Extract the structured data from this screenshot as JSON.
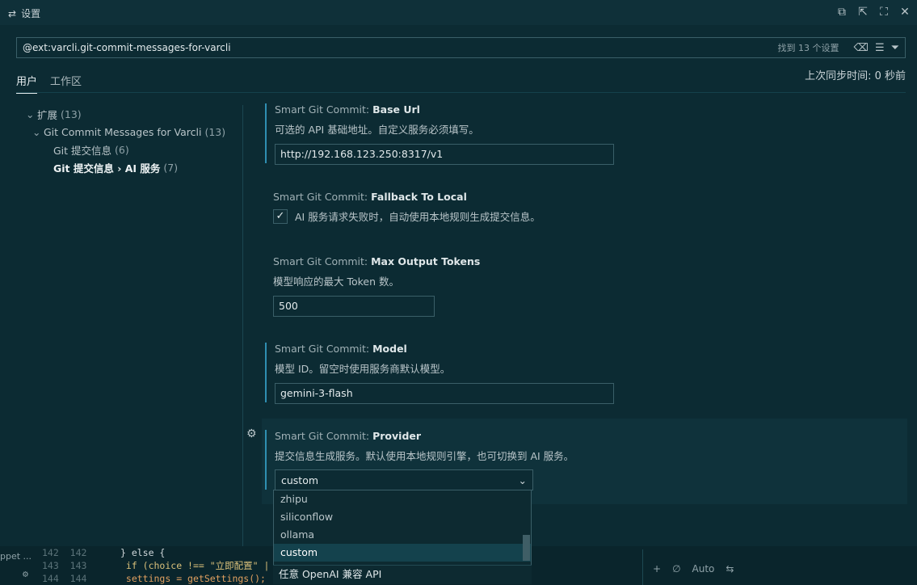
{
  "window": {
    "title": "设置",
    "title_icon": "settings-split-icon",
    "actions": [
      "copy-icon",
      "open-json-icon",
      "maximize-icon",
      "close-icon"
    ]
  },
  "search": {
    "value": "@ext:varcli.git-commit-messages-for-varcli",
    "result_count": "找到 13 个设置",
    "icons": [
      "clear-filter-icon",
      "list-icon",
      "filter-icon"
    ]
  },
  "tabs": [
    {
      "label": "用户",
      "active": true
    },
    {
      "label": "工作区",
      "active": false
    }
  ],
  "sync_status": "上次同步时间: 0 秒前",
  "tree": [
    {
      "label": "扩展",
      "count": "(13)",
      "expanded": true
    },
    {
      "label": "Git Commit Messages for Varcli",
      "count": "(13)",
      "expanded": true
    },
    {
      "label": "Git 提交信息",
      "count": "(6)"
    },
    {
      "label": "Git 提交信息 › AI 服务",
      "count": "(7)",
      "selected": true
    }
  ],
  "settings": {
    "base_url": {
      "prefix": "Smart Git Commit: ",
      "name": "Base Url",
      "desc": "可选的 API 基础地址。自定义服务必须填写。",
      "value": "http://192.168.123.250:8317/v1"
    },
    "fallback": {
      "prefix": "Smart Git Commit: ",
      "name": "Fallback To Local",
      "desc": "AI 服务请求失败时，自动使用本地规则生成提交信息。",
      "checked": true,
      "check_glyph": "✓"
    },
    "max_tokens": {
      "prefix": "Smart Git Commit: ",
      "name": "Max Output Tokens",
      "desc": "模型响应的最大 Token 数。",
      "value": "500"
    },
    "model": {
      "prefix": "Smart Git Commit: ",
      "name": "Model",
      "desc": "模型 ID。留空时使用服务商默认模型。",
      "value": "gemini-3-flash"
    },
    "provider": {
      "prefix": "Smart Git Commit: ",
      "name": "Provider",
      "desc": "提交信息生成服务。默认使用本地规则引擎，也可切换到 AI 服务。",
      "value": "custom",
      "options": [
        "zhipu",
        "siliconflow",
        "ollama",
        "custom"
      ],
      "selected_option": "custom",
      "option_description": "任意 OpenAI 兼容 API"
    }
  },
  "background_code": {
    "left_label": "ppet ...",
    "lines": [
      {
        "a": "142",
        "b": "142",
        "code": "} else {"
      },
      {
        "a": "143",
        "b": "143",
        "code": "  if (choice !== \"立即配置\" |"
      },
      {
        "a": "144",
        "b": "144",
        "code": "  settings = getSettings();"
      }
    ]
  },
  "background_panel": {
    "tools": [
      "+",
      "∅",
      "Auto",
      "⇆"
    ]
  },
  "colors": {
    "background": "#0c2b33",
    "accent": "#2f8fb2",
    "selected": "#14424d"
  }
}
